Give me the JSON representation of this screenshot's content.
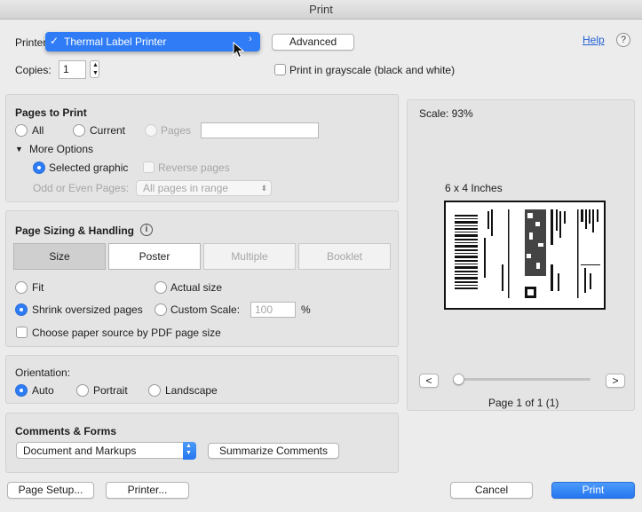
{
  "window": {
    "title": "Print"
  },
  "printer": {
    "label": "Printer:",
    "selected": "Thermal Label Printer",
    "advanced_label": "Advanced",
    "help_label": "Help",
    "help_icon": "?"
  },
  "copies": {
    "label": "Copies:",
    "value": "1"
  },
  "grayscale": {
    "label": "Print in grayscale (black and white)",
    "checked": false
  },
  "pages_to_print": {
    "title": "Pages to Print",
    "all_label": "All",
    "current_label": "Current",
    "pages_label": "Pages",
    "pages_value": "",
    "more_options_label": "More Options",
    "selected_graphic_label": "Selected graphic",
    "reverse_pages_label": "Reverse pages",
    "odd_even_label": "Odd or Even Pages:",
    "odd_even_value": "All pages in range"
  },
  "sizing": {
    "title": "Page Sizing & Handling",
    "tabs": [
      "Size",
      "Poster",
      "Multiple",
      "Booklet"
    ],
    "active_tab": "Size",
    "fit_label": "Fit",
    "actual_size_label": "Actual size",
    "shrink_label": "Shrink oversized pages",
    "custom_scale_label": "Custom Scale:",
    "custom_scale_value": "100",
    "percent_label": "%",
    "paper_source_label": "Choose paper source by PDF page size"
  },
  "orientation": {
    "title": "Orientation:",
    "auto_label": "Auto",
    "portrait_label": "Portrait",
    "landscape_label": "Landscape",
    "selected": "Auto"
  },
  "comments": {
    "title": "Comments & Forms",
    "selected": "Document and Markups",
    "summarize_label": "Summarize Comments"
  },
  "preview": {
    "scale_text": "Scale:  93%",
    "paper_label": "6 x 4 Inches",
    "prev_label": "<",
    "next_label": ">",
    "page_text": "Page 1 of 1 (1)",
    "slider_fraction": 0
  },
  "footer": {
    "page_setup_label": "Page Setup...",
    "printer_label": "Printer...",
    "cancel_label": "Cancel",
    "print_label": "Print"
  },
  "colors": {
    "accent": "#2d7cf6",
    "link": "#1f5fd6"
  }
}
